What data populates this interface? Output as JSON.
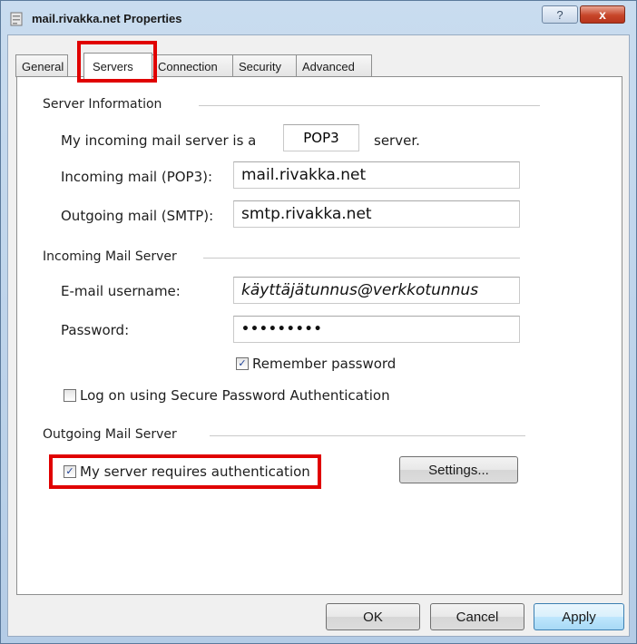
{
  "window": {
    "title": "mail.rivakka.net Properties",
    "help_label": "?",
    "close_label": "x"
  },
  "tabs": [
    {
      "label": "General"
    },
    {
      "label": "Servers"
    },
    {
      "label": "Connection"
    },
    {
      "label": "Security"
    },
    {
      "label": "Advanced"
    }
  ],
  "server_info": {
    "heading": "Server Information",
    "type_prefix": "My incoming mail server is a",
    "type_value": "POP3",
    "type_suffix": "server.",
    "incoming_label": "Incoming mail (POP3):",
    "incoming_value": "mail.rivakka.net",
    "outgoing_label": "Outgoing mail (SMTP):",
    "outgoing_value": "smtp.rivakka.net"
  },
  "incoming_server": {
    "heading": "Incoming Mail Server",
    "username_label": "E-mail username:",
    "username_value": "käyttäjätunnus@verkkotunnus",
    "password_label": "Password:",
    "password_value": "•••••••••",
    "remember_label": "Remember password",
    "remember_checked": true,
    "spa_label": "Log on using Secure Password Authentication",
    "spa_checked": false
  },
  "outgoing_server": {
    "heading": "Outgoing Mail Server",
    "auth_label": "My server requires authentication",
    "auth_checked": true,
    "settings_label": "Settings..."
  },
  "buttons": {
    "ok": "OK",
    "cancel": "Cancel",
    "apply": "Apply"
  },
  "check_mark": "✓",
  "colors": {
    "highlight": "#e00000",
    "title_bg": "#c9dcef",
    "close_button": "#c7462a"
  }
}
